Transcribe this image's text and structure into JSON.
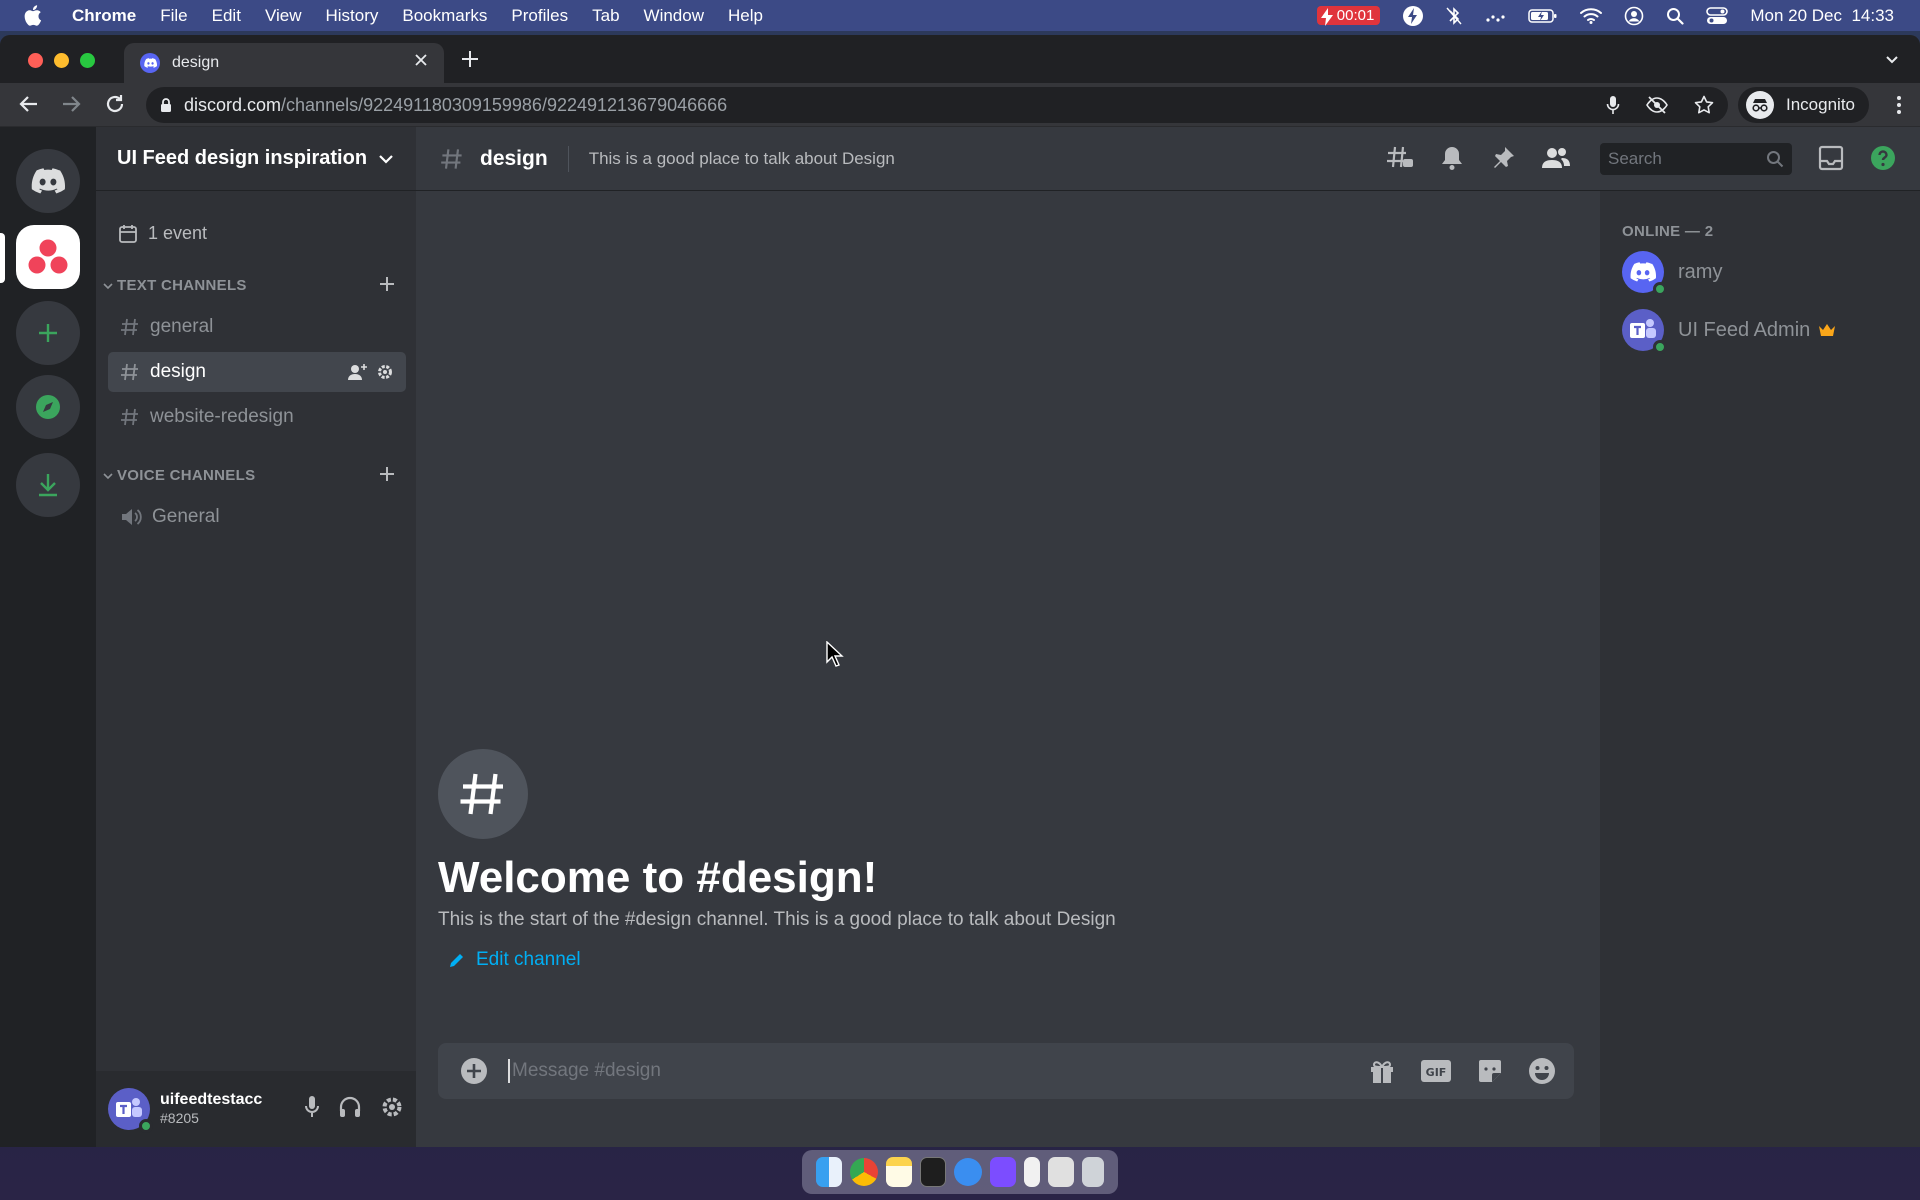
{
  "menubar": {
    "app": "Chrome",
    "items": [
      "File",
      "Edit",
      "View",
      "History",
      "Bookmarks",
      "Profiles",
      "Tab",
      "Window",
      "Help"
    ],
    "record_time": "00:01",
    "datetime": "Mon 20 Dec  14:33"
  },
  "browser": {
    "tab_title": "design",
    "url_host": "discord.com",
    "url_path": "/channels/922491180309159986/922491213679046666",
    "profile": "Incognito"
  },
  "server": {
    "name": "UI Feed design inspiration",
    "event": "1 event",
    "text_category": "TEXT CHANNELS",
    "voice_category": "VOICE CHANNELS",
    "text_channels": [
      "general",
      "design",
      "website-redesign"
    ],
    "voice_channels": [
      "General"
    ]
  },
  "user": {
    "name": "uifeedtestacc",
    "discriminator": "#8205"
  },
  "channel": {
    "name": "design",
    "topic": "This is a good place to talk about Design",
    "search_placeholder": "Search",
    "welcome_title": "Welcome to #design!",
    "welcome_sub": "This is the start of the #design channel. This is a good place to talk about Design",
    "edit_label": "Edit channel",
    "composer_placeholder": "Message #design"
  },
  "members": {
    "heading": "ONLINE — 2",
    "list": [
      "ramy",
      "UI Feed Admin"
    ]
  },
  "colors": {
    "accent": "#5865f2",
    "online": "#3ba55d",
    "link": "#00aff4"
  }
}
